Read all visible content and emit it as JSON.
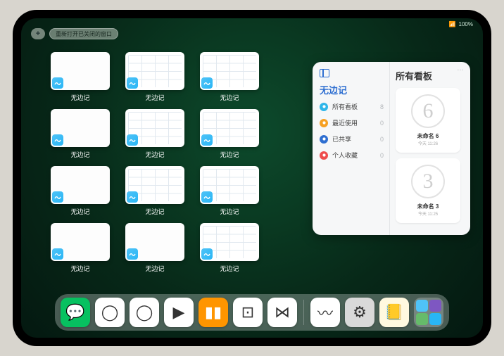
{
  "status": {
    "wifi": "📶",
    "battery": "100%"
  },
  "top": {
    "plus": "+",
    "reopen_label": "重新打开已关闭的窗口"
  },
  "app_window_label": "无边记",
  "windows": [
    {
      "variant": "blank"
    },
    {
      "variant": "grid"
    },
    {
      "variant": "grid"
    },
    {
      "variant": "blank"
    },
    {
      "variant": "grid"
    },
    {
      "variant": "grid"
    },
    {
      "variant": "blank"
    },
    {
      "variant": "grid"
    },
    {
      "variant": "grid"
    },
    {
      "variant": "blank"
    },
    {
      "variant": "blank"
    },
    {
      "variant": "grid"
    }
  ],
  "panel": {
    "left_title": "无边记",
    "right_title": "所有看板",
    "categories": [
      {
        "icon": "grid",
        "color": "ci-blue",
        "label": "所有看板",
        "count": "8"
      },
      {
        "icon": "clock",
        "color": "ci-orange",
        "label": "最近使用",
        "count": "0"
      },
      {
        "icon": "person",
        "color": "ci-bluer",
        "label": "已共享",
        "count": "0"
      },
      {
        "icon": "heart",
        "color": "ci-red",
        "label": "个人收藏",
        "count": "0"
      }
    ],
    "boards": [
      {
        "glyph": "6",
        "title": "未命名 6",
        "sub": "今天 11:26"
      },
      {
        "glyph": "3",
        "title": "未命名 3",
        "sub": "今天 11:25"
      }
    ]
  },
  "dock": {
    "apps": [
      {
        "name": "wechat",
        "bg": "#07c160",
        "glyph": "💬"
      },
      {
        "name": "quark",
        "bg": "#ffffff",
        "glyph": "◯"
      },
      {
        "name": "qqbrowser",
        "bg": "#ffffff",
        "glyph": "◯"
      },
      {
        "name": "play",
        "bg": "#ffffff",
        "glyph": "▶"
      },
      {
        "name": "books",
        "bg": "#ff9500",
        "glyph": "▮▮"
      },
      {
        "name": "dice",
        "bg": "#ffffff",
        "glyph": "⊡"
      },
      {
        "name": "connect",
        "bg": "#ffffff",
        "glyph": "⋈"
      }
    ],
    "recent": [
      {
        "name": "freeform",
        "bg": "#ffffff",
        "glyph": "〰"
      },
      {
        "name": "settings",
        "bg": "#d9d9d9",
        "glyph": "⚙"
      },
      {
        "name": "notes",
        "bg": "#fff9e0",
        "glyph": "📒"
      }
    ]
  }
}
